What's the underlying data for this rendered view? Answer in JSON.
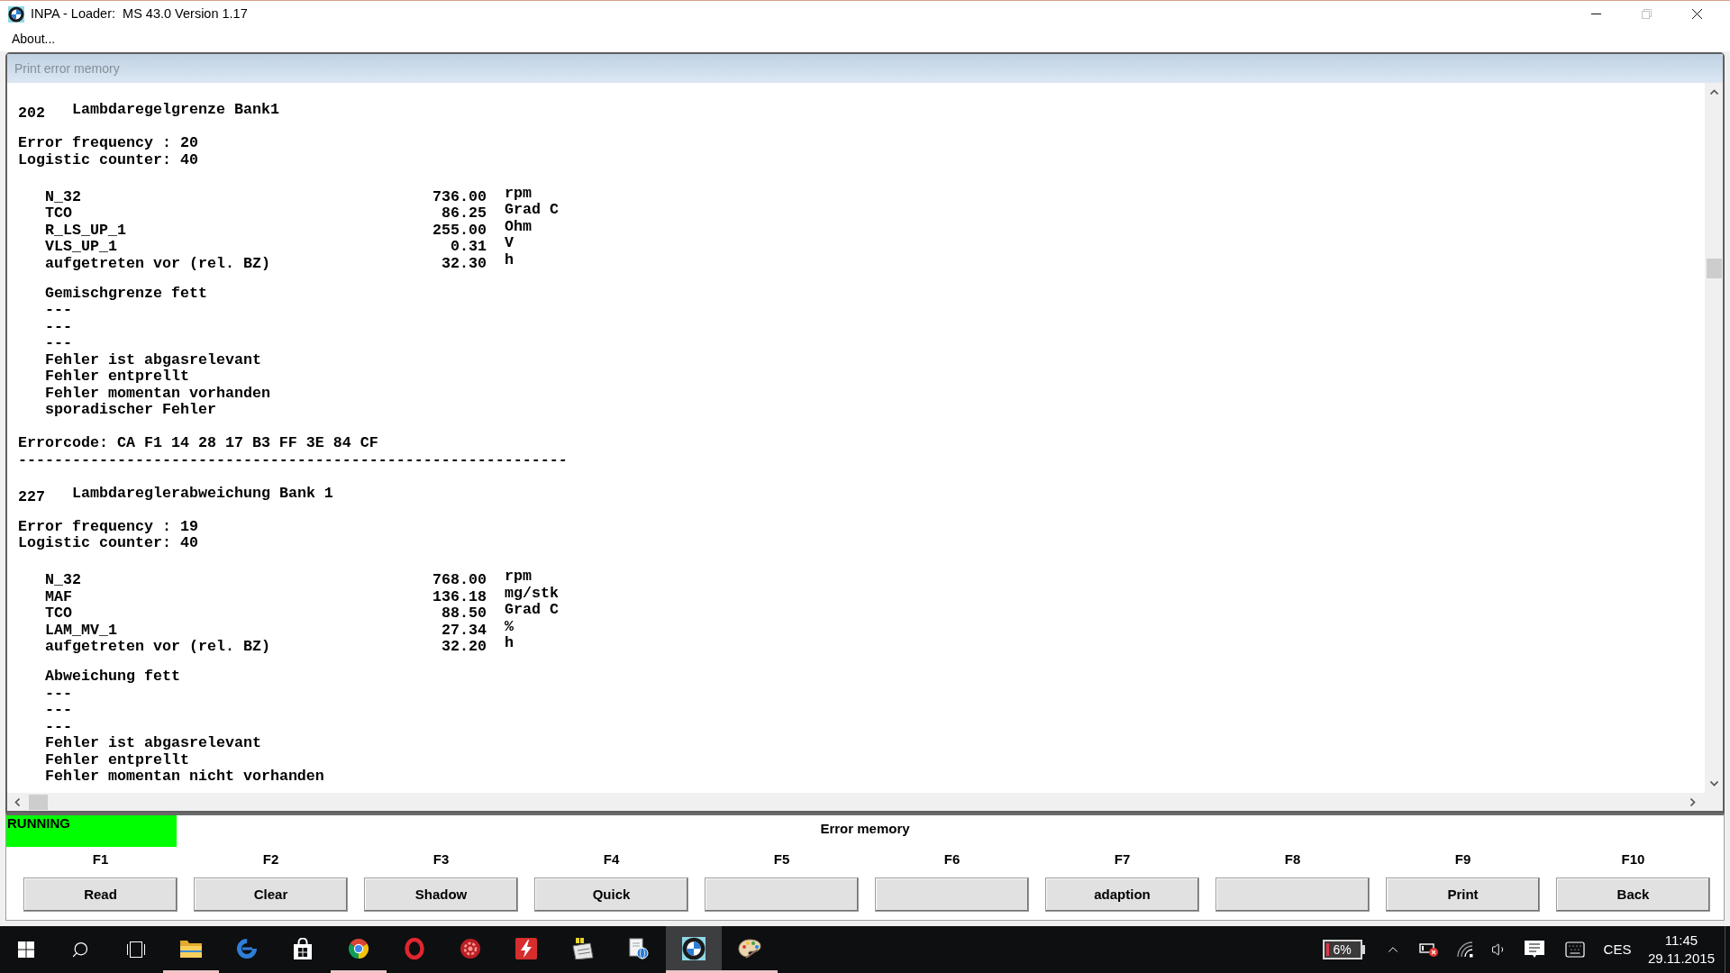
{
  "window": {
    "title": "INPA - Loader:  MS 43.0 Version 1.17",
    "controls": [
      {
        "kind": "minimize",
        "disabled": false
      },
      {
        "kind": "restore",
        "disabled": true
      },
      {
        "kind": "close",
        "disabled": false
      }
    ]
  },
  "menu": [
    {
      "label": "About..."
    }
  ],
  "document": {
    "title": "Print error memory",
    "active": false,
    "entries": [
      {
        "number": "202",
        "title": "Lambdaregelgrenze Bank1",
        "frequency": "Error frequency : 20",
        "counter": "Logistic counter: 40",
        "params": [
          {
            "name": "N_32",
            "value": "736.00",
            "unit": "rpm"
          },
          {
            "name": "TCO",
            "value": "86.25",
            "unit": "Grad C"
          },
          {
            "name": "R_LS_UP_1",
            "value": "255.00",
            "unit": "Ohm"
          },
          {
            "name": "VLS_UP_1",
            "value": "0.31",
            "unit": "V"
          },
          {
            "name": "aufgetreten vor (rel. BZ)",
            "value": "32.30",
            "unit": "h"
          }
        ],
        "flags": [
          "Gemischgrenze fett",
          "---",
          "---",
          "---",
          "Fehler ist abgasrelevant",
          "Fehler entprellt",
          "Fehler momentan vorhanden",
          "sporadischer Fehler"
        ],
        "errorcode": "Errorcode: CA F1 14 28 17 B3 FF 3E 84 CF",
        "separator": "-------------------------------------------------------------"
      },
      {
        "number": "227",
        "title": "Lambdareglerabweichung Bank 1",
        "frequency": "Error frequency : 19",
        "counter": "Logistic counter: 40",
        "params": [
          {
            "name": "N_32",
            "value": "768.00",
            "unit": "rpm"
          },
          {
            "name": "MAF",
            "value": "136.18",
            "unit": "mg/stk"
          },
          {
            "name": "TCO",
            "value": "88.50",
            "unit": "Grad C"
          },
          {
            "name": "LAM_MV_1",
            "value": "27.34",
            "unit": "%"
          },
          {
            "name": "aufgetreten vor (rel. BZ)",
            "value": "32.20",
            "unit": "h"
          }
        ],
        "flags": [
          "Abweichung fett",
          "---",
          "---",
          "---",
          "Fehler ist abgasrelevant",
          "Fehler entprellt",
          "Fehler momentan nicht vorhanden"
        ]
      }
    ]
  },
  "status": {
    "text": "RUNNING"
  },
  "panel_title": "Error memory",
  "function_keys": [
    {
      "key": "F1",
      "label": "Read"
    },
    {
      "key": "F2",
      "label": "Clear"
    },
    {
      "key": "F3",
      "label": "Shadow"
    },
    {
      "key": "F4",
      "label": "Quick"
    },
    {
      "key": "F5"
    },
    {
      "key": "F6"
    },
    {
      "key": "F7",
      "label": "adaption"
    },
    {
      "key": "F8"
    },
    {
      "key": "F9",
      "label": "Print"
    },
    {
      "key": "F10",
      "label": "Back"
    }
  ],
  "taskbar": {
    "apps": [
      {
        "kind": "folder",
        "running": true,
        "selected": false
      },
      {
        "kind": "swirl",
        "running": false,
        "selected": false
      },
      {
        "kind": "bag",
        "running": false,
        "selected": false
      },
      {
        "kind": "wheel",
        "running": true,
        "selected": false
      },
      {
        "kind": "ring",
        "running": false,
        "selected": false
      },
      {
        "kind": "cog",
        "running": false,
        "selected": false
      },
      {
        "kind": "bolt",
        "running": false,
        "selected": false
      },
      {
        "kind": "notepad",
        "running": false,
        "selected": false
      },
      {
        "kind": "globe",
        "running": false,
        "selected": false
      },
      {
        "kind": "roundel",
        "running": true,
        "selected": true
      },
      {
        "kind": "palette",
        "running": true,
        "selected": false
      }
    ],
    "battery": "6%",
    "language": "CES",
    "time": "11:45",
    "date": "29.11.2015"
  }
}
